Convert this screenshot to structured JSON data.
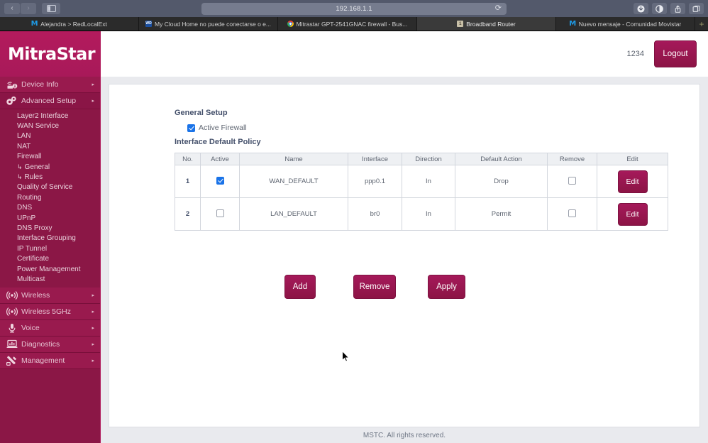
{
  "browser": {
    "url": "192.168.1.1",
    "nav": {
      "back_label": "‹",
      "forward_label": "›",
      "sidebar_toggle_label": "sidebar-toggle",
      "reload_label": "⟳"
    },
    "toolbar_right": [
      {
        "name": "downloads-icon",
        "glyph": "⬇"
      },
      {
        "name": "reader-contrast-icon",
        "glyph": "◐"
      },
      {
        "name": "share-icon",
        "glyph": "↑"
      },
      {
        "name": "tabs-overview-icon",
        "glyph": "⧉"
      }
    ],
    "tabs": [
      {
        "label": "Alejandra > RedLocalExt",
        "favicon": "movistar-icon",
        "active": false
      },
      {
        "label": "My Cloud Home no puede conectarse o e...",
        "favicon": "wd-icon",
        "active": false
      },
      {
        "label": "Mitrastar GPT-2541GNAC firewall - Bus...",
        "favicon": "chrome-icon",
        "active": false
      },
      {
        "label": "Broadband Router",
        "favicon": "router-icon",
        "active": true
      },
      {
        "label": "Nuevo mensaje - Comunidad Movistar",
        "favicon": "movistar-icon",
        "active": false
      }
    ],
    "new_tab_label": "+"
  },
  "sidebar": {
    "logo": "MitraStar",
    "top_items": [
      {
        "label": "Device Info",
        "icon": "device-info-icon",
        "arrow": "▸",
        "selected": false
      },
      {
        "label": "Advanced Setup",
        "icon": "gears-icon",
        "arrow": "▸",
        "selected": true
      }
    ],
    "sub_items": [
      {
        "label": "Layer2 Interface",
        "hook": false
      },
      {
        "label": "WAN Service",
        "hook": false
      },
      {
        "label": "LAN",
        "hook": false
      },
      {
        "label": "NAT",
        "hook": false
      },
      {
        "label": "Firewall",
        "hook": false
      },
      {
        "label": "General",
        "hook": true
      },
      {
        "label": "Rules",
        "hook": true
      },
      {
        "label": "Quality of Service",
        "hook": false
      },
      {
        "label": "Routing",
        "hook": false
      },
      {
        "label": "DNS",
        "hook": false
      },
      {
        "label": "UPnP",
        "hook": false
      },
      {
        "label": "DNS Proxy",
        "hook": false
      },
      {
        "label": "Interface Grouping",
        "hook": false
      },
      {
        "label": "IP Tunnel",
        "hook": false
      },
      {
        "label": "Certificate",
        "hook": false
      },
      {
        "label": "Power Management",
        "hook": false
      },
      {
        "label": "Multicast",
        "hook": false
      }
    ],
    "hook_glyph": "↳",
    "bottom_items": [
      {
        "label": "Wireless",
        "icon": "wireless-icon",
        "arrow": "▸"
      },
      {
        "label": "Wireless 5GHz",
        "icon": "wireless-5ghz-icon",
        "arrow": "▸"
      },
      {
        "label": "Voice",
        "icon": "microphone-icon",
        "arrow": "▸"
      },
      {
        "label": "Diagnostics",
        "icon": "diagnostics-icon",
        "arrow": "▸"
      },
      {
        "label": "Management",
        "icon": "tools-icon",
        "arrow": "▸"
      }
    ]
  },
  "topbar": {
    "user_id": "1234",
    "logout_label": "Logout"
  },
  "main": {
    "general_setup_title": "General Setup",
    "active_firewall_label": "Active Firewall",
    "active_firewall_checked": true,
    "policy_title": "Interface Default Policy",
    "table": {
      "headers": [
        "No.",
        "Active",
        "Name",
        "Interface",
        "Direction",
        "Default Action",
        "Remove",
        "Edit"
      ],
      "rows": [
        {
          "no": "1",
          "active": true,
          "name": "WAN_DEFAULT",
          "interface": "ppp0.1",
          "direction": "In",
          "default_action": "Drop",
          "remove": false,
          "edit_label": "Edit"
        },
        {
          "no": "2",
          "active": false,
          "name": "LAN_DEFAULT",
          "interface": "br0",
          "direction": "In",
          "default_action": "Permit",
          "remove": false,
          "edit_label": "Edit"
        }
      ]
    },
    "actions": {
      "add_label": "Add",
      "remove_label": "Remove",
      "apply_label": "Apply"
    }
  },
  "footer": {
    "copyright": "MSTC. All rights reserved."
  },
  "colors": {
    "brand_magenta": "#b01a5b",
    "brand_maroon": "#8b1746",
    "button_maroon": "#a5195a",
    "checkbox_blue": "#1a73e8",
    "text_slate": "#5d6470",
    "panel_grey": "#e9eaee"
  }
}
